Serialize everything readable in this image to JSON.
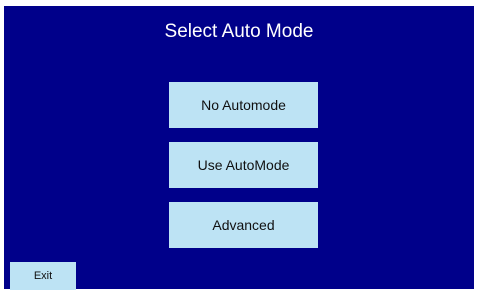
{
  "screen": {
    "title": "Select Auto Mode",
    "background_color": "#00008a"
  },
  "mode_buttons": [
    {
      "label": "No Automode"
    },
    {
      "label": "Use AutoMode"
    },
    {
      "label": "Advanced"
    }
  ],
  "exit": {
    "label": "Exit"
  },
  "colors": {
    "button_fill": "#bde3f4",
    "button_text": "#111111",
    "title_text": "#ffffff"
  }
}
